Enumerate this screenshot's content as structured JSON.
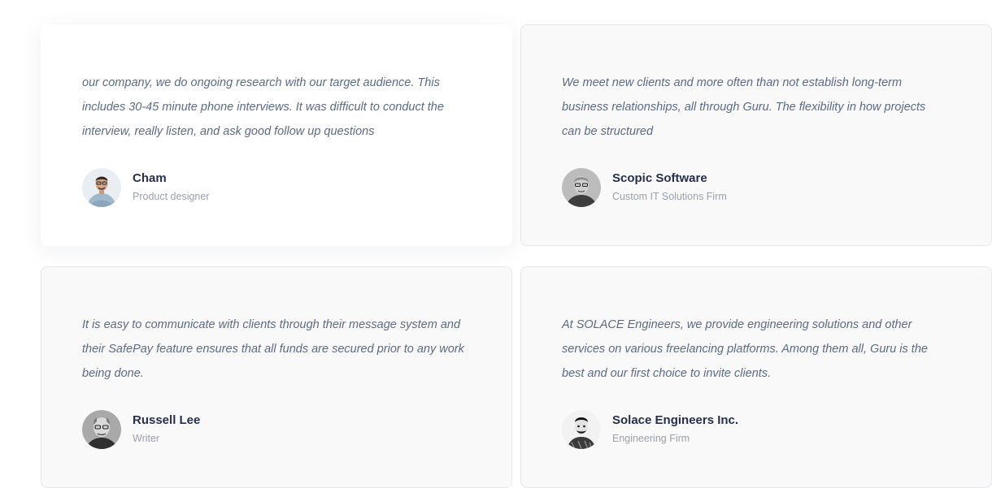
{
  "testimonials": [
    {
      "quote": " our company, we do ongoing research with our target audience. This includes 30-45 minute phone interviews. It was difficult to conduct the interview, really listen, and ask good follow up questions",
      "name": "Cham",
      "role": "Product designer",
      "avatar_icon": "person-photo-cham"
    },
    {
      "quote": "We meet new clients and more often than not establish long-term business relationships, all through Guru. The flexibility in how projects can be structured",
      "name": "Scopic Software",
      "role": "Custom IT Solutions Firm",
      "avatar_icon": "person-photo-scopic"
    },
    {
      "quote": "It is easy to communicate with clients through their message system and their SafePay feature ensures that all funds are secured prior to any work being done.",
      "name": "Russell Lee",
      "role": "Writer",
      "avatar_icon": "person-photo-russell"
    },
    {
      "quote": "At SOLACE Engineers, we provide engineering solutions and other services on various freelancing platforms. Among them all, Guru is the best and our first choice to invite clients.",
      "name": "Solace Engineers Inc.",
      "role": "Engineering Firm",
      "avatar_icon": "person-photo-solace"
    }
  ],
  "colors": {
    "quote_text": "#5c6b83",
    "name_text": "#27304a",
    "role_text": "#9aa1ad",
    "card_bg": "#f9f9fa",
    "card_border": "#e6e7ea"
  }
}
